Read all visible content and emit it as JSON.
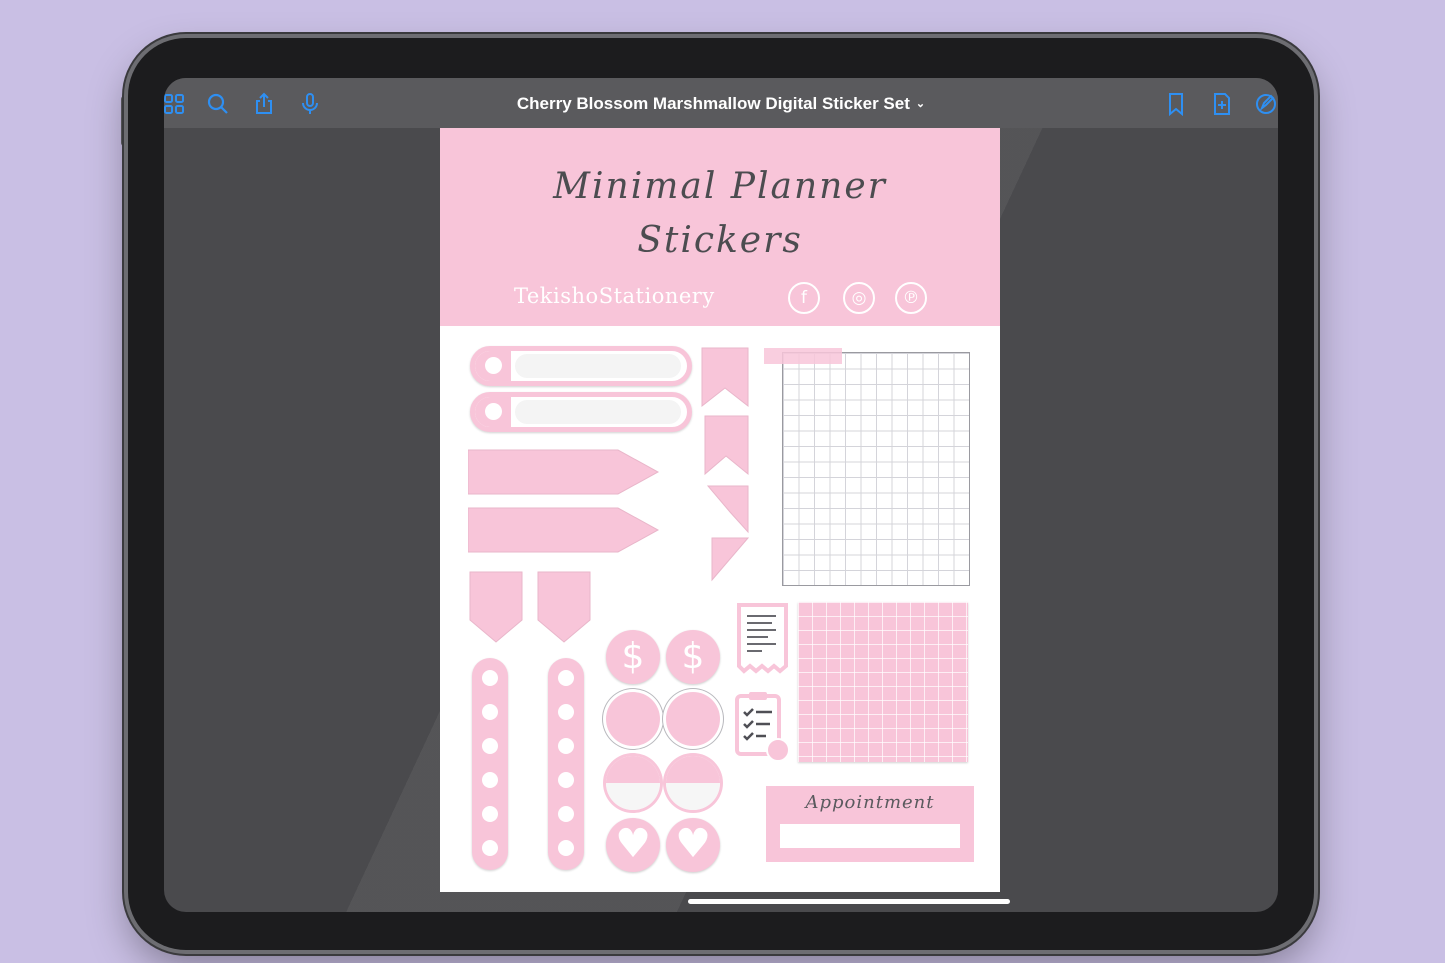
{
  "toolbar": {
    "doc_title": "Cherry Blossom Marshmallow Digital Sticker Set",
    "left_icons": [
      "thumbnails-grid-icon",
      "search-icon",
      "share-icon",
      "microphone-icon"
    ],
    "right_icons": [
      "bookmark-icon",
      "add-page-icon",
      "markup-pen-icon"
    ],
    "accent": "#2e8ff2"
  },
  "sticker_sheet": {
    "title_line1": "Minimal Planner",
    "title_line2": "Stickers",
    "brand": "TekishoStationery",
    "social": [
      "facebook-icon",
      "instagram-icon",
      "pinterest-icon"
    ],
    "pink": "#f8c5d9",
    "appointment_label": "Appointment",
    "dollar_glyph": "$",
    "heart_glyph": "♥"
  },
  "colors": {
    "background": "#c9bfe4",
    "screen": "#4a4a4d",
    "toolbar": "#5a5a5d"
  }
}
